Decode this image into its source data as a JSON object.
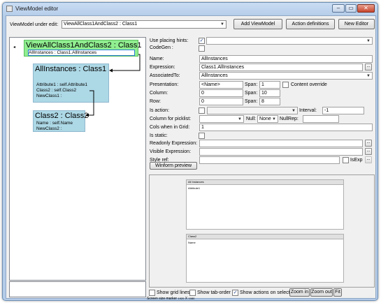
{
  "window": {
    "title": "ViewModel editor",
    "min_glyph": "–",
    "max_glyph": "▭",
    "close_glyph": "✕"
  },
  "toolbar": {
    "vm_label": "ViewModel under edit:",
    "vm_value": "ViewAllClass1AndClass2 : Class1",
    "add_viewmodel": "Add ViewModel",
    "action_definitions": "Action definitions",
    "new_editor": "New Editor"
  },
  "tree": {
    "root_glyph": "◂",
    "classes": [
      {
        "name": "ViewAllClass1AndClass2 : Class1",
        "attributes": [
          "AllInstances : Class1.AllInstances"
        ]
      },
      {
        "name": "AllInstances : Class1",
        "attributes": [
          "Attribute1 : self.Attribute1",
          "Class2 : self.Class2",
          "NewClass1 :"
        ]
      },
      {
        "name": "Class2 : Class2",
        "attributes": [
          "Name : self.Name",
          "NewClass2 :"
        ]
      }
    ]
  },
  "props": {
    "use_placing_hints": "Use placing hints:",
    "codegen": "CodeGen :",
    "name_label": "Name:",
    "name_value": "AllInstances",
    "expression_label": "Expression:",
    "expression_value": "Class1.AllInstances",
    "associated_label": "AssociatedTo:",
    "associated_value": "AllInstances",
    "presentation_label": "Presentation:",
    "presentation_value": "<Name>",
    "span_label": "Span:",
    "span1": "1",
    "content_override": "Content override",
    "column_label": "Column:",
    "column_value": "0",
    "span2": "10",
    "row_label": "Row:",
    "row_value": "0",
    "span3": "8",
    "is_action_label": "Is action:",
    "interval_label": "Interval:",
    "interval_value": "-1",
    "picklist_label": "Column for picklist:",
    "null_label": "Null:",
    "null_value": "None",
    "nullrep_label": "NullRep:",
    "cols_label": "Cols when in Grid:",
    "cols_value": "1",
    "is_static_label": "Is static:",
    "readonly_label": "Readonly Expression:",
    "visible_label": "Visible Expression:",
    "style_label": "Style ref:",
    "isexp_label": "IsExp",
    "winform_preview": "Winform preview",
    "ellipsis": "..."
  },
  "preview": {
    "box1_title": "All Instances",
    "box1_row": "Attribute1",
    "box2_title": "Class2",
    "box2_row": "Name"
  },
  "bottom": {
    "show_grid_lines": "Show grid lines",
    "show_tab_order": "Show tab-order",
    "show_actions": "Show actions on select",
    "zoom_in": "Zoom in",
    "zoom_out": "Zoom out",
    "fit": "Fit",
    "size_marker_label": "Screen size marker",
    "size_w": "1920",
    "size_x": "X",
    "size_h": "1080"
  },
  "colors": {
    "root_fill": "#90ee90",
    "class_fill": "#add8e6",
    "selected_border": "#2a7fd4",
    "check_color": "#1a3d8a"
  }
}
